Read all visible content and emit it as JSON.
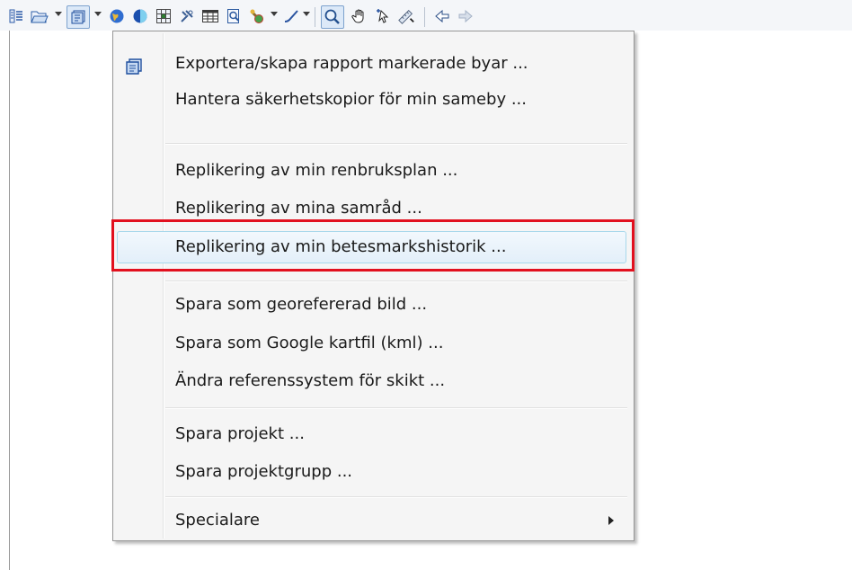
{
  "toolbar": {
    "icons": [
      "layers-icon",
      "open-folder-icon",
      "export-icon",
      "globe-icon",
      "contrast-icon",
      "grid-map-icon",
      "wrench-icon",
      "table-icon",
      "report-icon",
      "gps-icon",
      "pen-icon",
      "zoom-icon",
      "pan-hand-icon",
      "select-arrow-icon",
      "measure-icon",
      "back-icon",
      "forward-icon"
    ],
    "active_icons": [
      "export-icon",
      "zoom-icon"
    ]
  },
  "menu": {
    "items": [
      {
        "label": "Exportera/skapa rapport markerade byar ...",
        "icon": "export-icon"
      },
      {
        "label": "Hantera säkerhetskopior för min sameby ..."
      },
      {
        "label": "Replikering av min renbruksplan ..."
      },
      {
        "label": "Replikering av mina samråd ..."
      },
      {
        "label": "Replikering av min betesmarkshistorik ...",
        "highlighted": true
      },
      {
        "label": "Spara som georefererad bild ..."
      },
      {
        "label": "Spara som Google kartfil (kml) ..."
      },
      {
        "label": "Ändra referenssystem för skikt ..."
      },
      {
        "label": "Spara projekt ..."
      },
      {
        "label": "Spara projektgrupp ..."
      },
      {
        "label": "Specialare",
        "has_submenu": true
      }
    ]
  },
  "colors": {
    "highlight_border": "#e2101e",
    "hover_border": "#a8d8eb",
    "menu_bg": "#f5f5f5"
  }
}
